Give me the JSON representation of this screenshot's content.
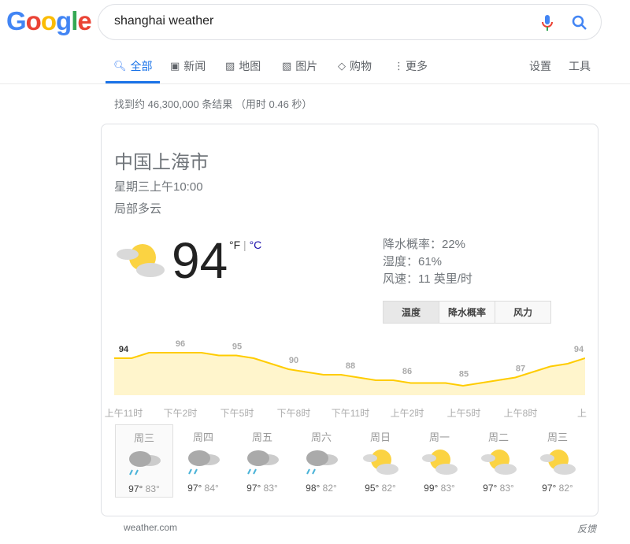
{
  "logo": "Google",
  "search": {
    "query": "shanghai weather"
  },
  "tabs": [
    {
      "label": "全部",
      "icon": "search-icon"
    },
    {
      "label": "新闻",
      "icon": "news-icon"
    },
    {
      "label": "地图",
      "icon": "map-icon"
    },
    {
      "label": "图片",
      "icon": "image-icon"
    },
    {
      "label": "购物",
      "icon": "tag-icon"
    },
    {
      "label": "更多",
      "icon": "more-vert-icon"
    }
  ],
  "tools": {
    "settings": "设置",
    "tools": "工具"
  },
  "stats": "找到约 46,300,000 条结果 （用时 0.46 秒）",
  "weather": {
    "location": "中国上海市",
    "time": "星期三上午10:00",
    "condition": "局部多云",
    "temp": "94",
    "unit_f": "°F",
    "sep": " | ",
    "unit_c": "°C",
    "precip": "降水概率：22%",
    "humidity": "湿度：61%",
    "wind": "风速：11 英里/时",
    "buttons": [
      "温度",
      "降水概率",
      "风力"
    ],
    "accent": "#ffcc00",
    "fill": "#fff5cc"
  },
  "chart_data": {
    "type": "area",
    "x": [
      "上午10:30",
      "上午11时",
      "中午12时",
      "下午1时",
      "下午2时",
      "下午3时",
      "下午4时",
      "下午5时",
      "下午6时",
      "下午7时",
      "下午8时",
      "下午9时",
      "下午10时",
      "下午11时",
      "上午0时",
      "上午1时",
      "上午2时",
      "上午3时",
      "上午4时",
      "上午5时",
      "上午6时",
      "上午7时",
      "上午8时",
      "上午9时",
      "上午10时",
      "上午11时"
    ],
    "values": [
      94,
      94,
      96,
      96,
      96,
      96,
      95,
      95,
      94,
      92,
      90,
      89,
      88,
      88,
      87,
      86,
      86,
      85,
      85,
      85,
      84,
      85,
      86,
      87,
      89,
      91,
      92,
      94
    ],
    "labels": [
      "94",
      "96",
      "95",
      "90",
      "88",
      "86",
      "85",
      "87",
      "94"
    ],
    "ticks": [
      "上午11时",
      "下午2时",
      "下午5时",
      "下午8时",
      "下午11时",
      "上午2时",
      "上午5时",
      "上午8时",
      "上"
    ]
  },
  "days": [
    {
      "name": "周三",
      "icon": "rain-cloud-icon",
      "hi": "97°",
      "lo": "83°"
    },
    {
      "name": "周四",
      "icon": "rain-cloud-icon",
      "hi": "97°",
      "lo": "84°"
    },
    {
      "name": "周五",
      "icon": "rain-cloud-icon",
      "hi": "97°",
      "lo": "83°"
    },
    {
      "name": "周六",
      "icon": "rain-cloud-icon",
      "hi": "98°",
      "lo": "82°"
    },
    {
      "name": "周日",
      "icon": "partly-cloudy-icon",
      "hi": "95°",
      "lo": "82°"
    },
    {
      "name": "周一",
      "icon": "partly-cloudy-icon",
      "hi": "99°",
      "lo": "83°"
    },
    {
      "name": "周二",
      "icon": "partly-cloudy-icon",
      "hi": "97°",
      "lo": "83°"
    },
    {
      "name": "周三",
      "icon": "partly-cloudy-icon",
      "hi": "97°",
      "lo": "82°"
    }
  ],
  "footer": {
    "source": "weather.com",
    "feedback": "反馈"
  }
}
